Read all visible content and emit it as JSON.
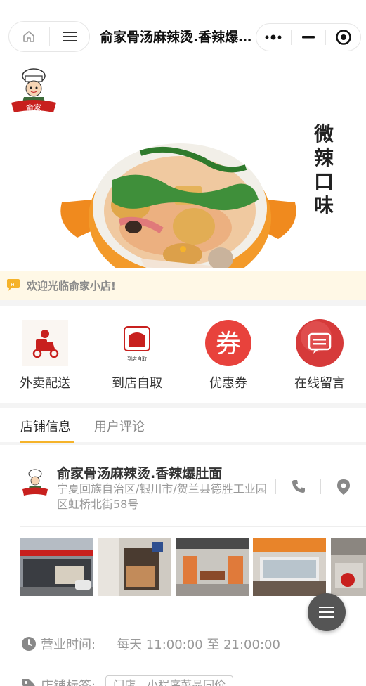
{
  "nav": {
    "title": "俞家骨汤麻辣烫.香辣爆肚面",
    "home_icon": "home-icon",
    "menu_icon": "menu-icon",
    "more_icon": "more-icon",
    "minimize_icon": "minimize-icon",
    "close_icon": "target-icon"
  },
  "banner": {
    "brand_badge": "俞家",
    "side_text": "微辣口味",
    "side_chars": [
      "微",
      "辣",
      "口",
      "味"
    ]
  },
  "notice": {
    "badge": "Hi",
    "text": "欢迎光临俞家小店!"
  },
  "actions": [
    {
      "label": "外卖配送",
      "icon": "delivery-icon"
    },
    {
      "label": "到店自取",
      "icon": "pickup-icon",
      "icon_caption": "到店自取"
    },
    {
      "label": "优惠券",
      "icon": "coupon-icon",
      "icon_glyph": "券"
    },
    {
      "label": "在线留言",
      "icon": "message-icon"
    }
  ],
  "tabs": [
    {
      "label": "店铺信息",
      "active": true
    },
    {
      "label": "用户评论",
      "active": false
    }
  ],
  "store": {
    "name": "俞家骨汤麻辣烫.香辣爆肚面",
    "address": "宁夏回族自治区/银川市/贺兰县德胜工业园区虹桥北街58号",
    "hours_label": "营业时间:",
    "hours_value": "每天 11:00:00 至 21:00:00",
    "tags_label": "店铺标签:",
    "tag": "门店、小程序菜品同价"
  },
  "colors": {
    "accent": "#f5b32a",
    "notice_bg": "#fff8e6",
    "coupon_red": "#e8423c",
    "text_muted": "#999999"
  }
}
